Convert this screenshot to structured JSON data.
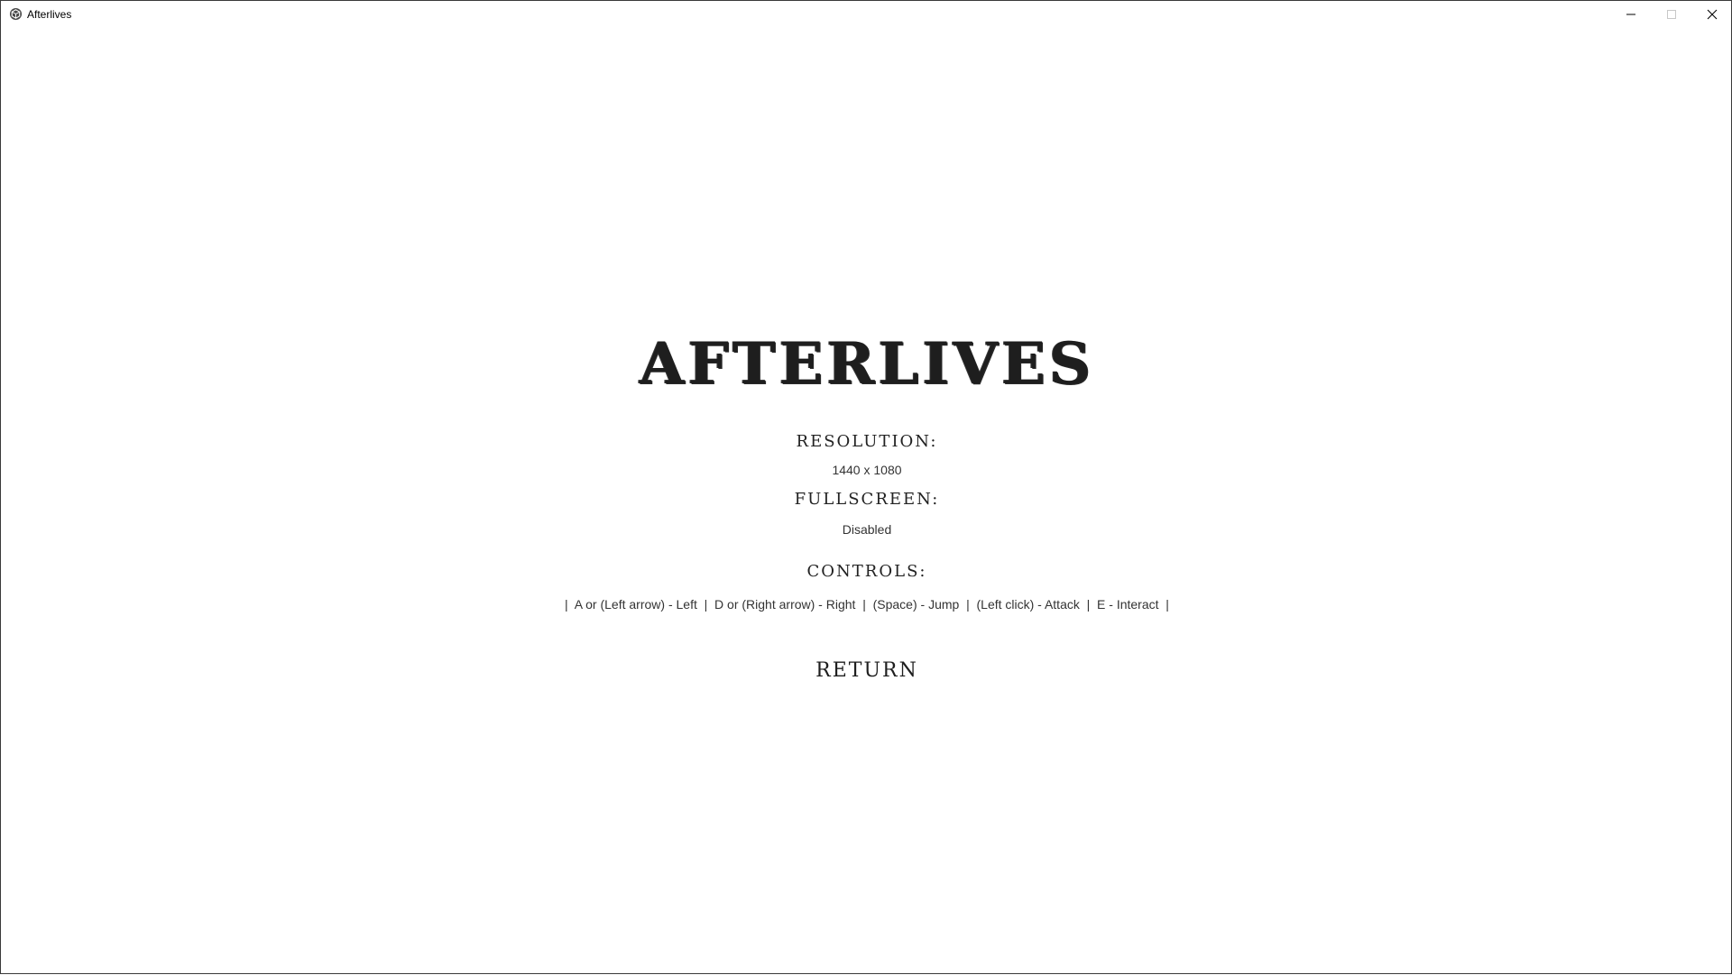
{
  "window": {
    "title": "Afterlives",
    "app_icon": "unity-cube-icon",
    "controls": {
      "minimize_icon": "minimize-icon",
      "maximize_icon": "maximize-icon",
      "close_icon": "close-icon"
    }
  },
  "game": {
    "title": "AFTERLIVES"
  },
  "settings": {
    "resolution_heading": "RESOLUTION:",
    "resolution_value": "1440 x 1080",
    "fullscreen_heading": "FULLSCREEN:",
    "fullscreen_value": "Disabled",
    "controls_heading": "CONTROLS:",
    "controls_text": "|  A or (Left arrow) - Left  |  D or (Right arrow) - Right  |  (Space) - Jump  |  (Left click) - Attack  |  E - Interact  |"
  },
  "menu": {
    "return_label": "RETURN"
  },
  "colors": {
    "background": "#ffffff",
    "text": "#1e1e1e"
  }
}
